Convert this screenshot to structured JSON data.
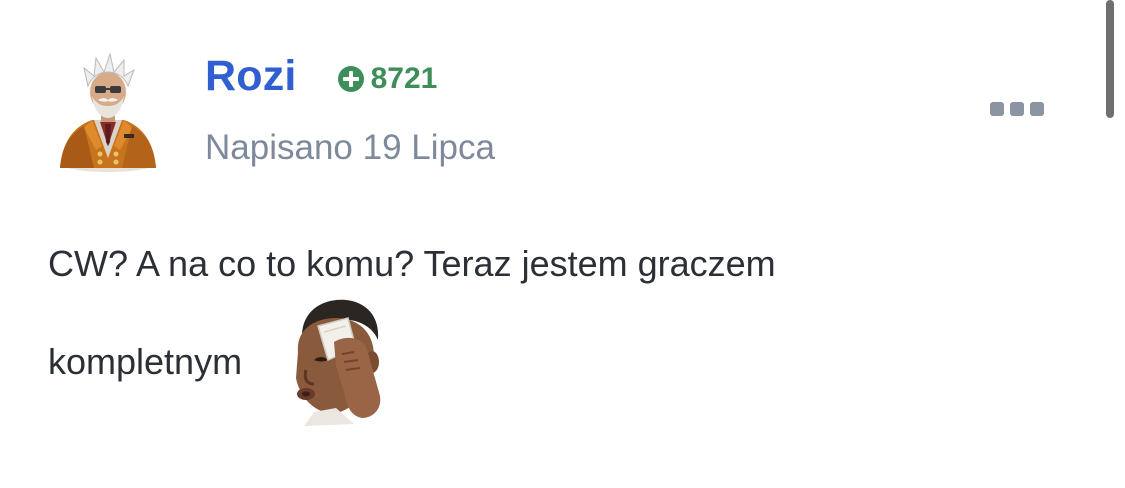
{
  "post": {
    "author": {
      "name": "Rozi",
      "reputation": "8721",
      "avatar_icon": "character-avatar-icon"
    },
    "date": "Napisano 19 Lipca",
    "menu_icon": "more-options-icon",
    "content": {
      "line1": "CW? A na co to komu? Teraz jestem graczem",
      "line2": "kompletnym",
      "emoticon_icon": "wiping-sweat-emoticon-icon"
    }
  },
  "colors": {
    "author_name": "#2f5fd0",
    "reputation": "#3e8e5a",
    "date": "#7e8a9c",
    "body_text": "#2b2f36",
    "menu_dots": "#8b94a3"
  }
}
